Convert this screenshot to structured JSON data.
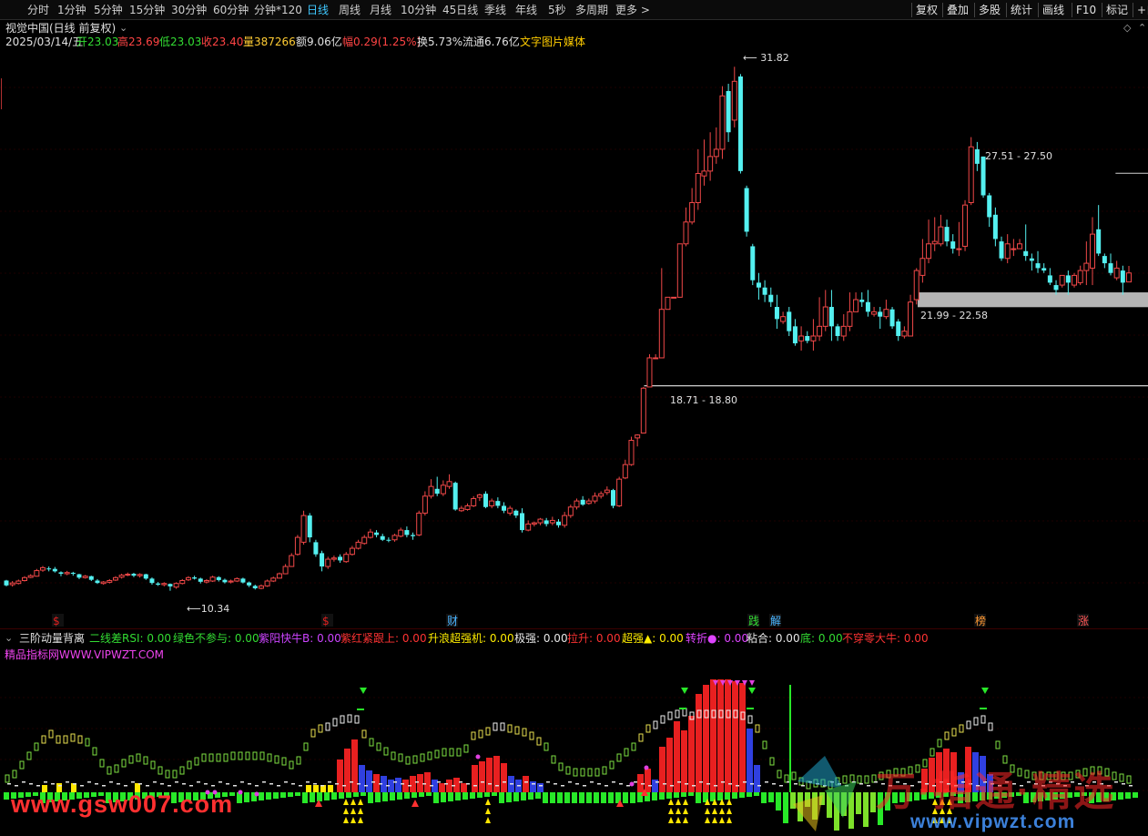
{
  "toolbar": {
    "periods": [
      "分时",
      "1分钟",
      "5分钟",
      "15分钟",
      "30分钟",
      "60分钟",
      "分钟*120",
      "日线",
      "周线",
      "月线",
      "10分钟",
      "45日线",
      "季线",
      "年线",
      "5秒",
      "多周期",
      "更多 >"
    ],
    "active": "日线",
    "right": [
      "复权",
      "叠加",
      "多股",
      "统计",
      "画线",
      "F10",
      "标记",
      "+自"
    ]
  },
  "stock": {
    "title": "视觉中国(日线 前复权)"
  },
  "quote": {
    "date": "2025/03/14/五",
    "open_label": "开",
    "open": "23.03",
    "high_label": "高",
    "high": "23.69",
    "low_label": "低",
    "low": "23.03",
    "close_label": "收",
    "close": "23.40",
    "vol_label": "量",
    "vol": "387266",
    "amt_label": "额",
    "amt": "9.06亿",
    "chg_label": "幅",
    "chg": "0.29(1.25%)",
    "turn_label": "换",
    "turn": "5.73%",
    "float_label": "流通",
    "float": "6.76亿",
    "tags": "文字图片媒体"
  },
  "chart_data": {
    "type": "candlestick",
    "ylim": [
      9.8,
      32.4
    ],
    "candles": [
      [
        10.72,
        10.52,
        10.75,
        10.48
      ],
      [
        10.55,
        10.62,
        10.7,
        10.47
      ],
      [
        10.6,
        10.7,
        10.76,
        10.56
      ],
      [
        10.72,
        10.84,
        10.9,
        10.68
      ],
      [
        10.85,
        10.92,
        10.98,
        10.82
      ],
      [
        10.9,
        11.13,
        11.2,
        10.88
      ],
      [
        11.15,
        11.25,
        11.32,
        11.08
      ],
      [
        11.22,
        11.18,
        11.3,
        11.1
      ],
      [
        11.2,
        11.1,
        11.28,
        11.05
      ],
      [
        11.06,
        11.0,
        11.1,
        10.9
      ],
      [
        11.0,
        11.05,
        11.12,
        10.94
      ],
      [
        11.04,
        11.0,
        11.08,
        10.92
      ],
      [
        10.98,
        10.84,
        11.0,
        10.78
      ],
      [
        10.84,
        10.9,
        10.95,
        10.8
      ],
      [
        10.9,
        10.75,
        10.92,
        10.7
      ],
      [
        10.72,
        10.62,
        10.78,
        10.58
      ],
      [
        10.6,
        10.66,
        10.7,
        10.55
      ],
      [
        10.65,
        10.72,
        10.78,
        10.6
      ],
      [
        10.74,
        10.84,
        10.9,
        10.7
      ],
      [
        10.86,
        10.94,
        11.0,
        10.8
      ],
      [
        10.95,
        10.98,
        11.05,
        10.9
      ],
      [
        11.0,
        10.92,
        11.04,
        10.86
      ],
      [
        10.92,
        10.97,
        11.02,
        10.84
      ],
      [
        10.98,
        10.8,
        11.0,
        10.75
      ],
      [
        10.8,
        10.62,
        10.85,
        10.55
      ],
      [
        10.6,
        10.55,
        10.66,
        10.5
      ],
      [
        10.55,
        10.6,
        10.65,
        10.48
      ],
      [
        10.58,
        10.48,
        10.6,
        10.3
      ],
      [
        10.45,
        10.6,
        10.65,
        10.38
      ],
      [
        10.6,
        10.72,
        10.78,
        10.56
      ],
      [
        10.75,
        10.84,
        10.9,
        10.7
      ],
      [
        10.85,
        10.8,
        10.92,
        10.76
      ],
      [
        10.8,
        10.67,
        10.84,
        10.6
      ],
      [
        10.66,
        10.72,
        10.78,
        10.6
      ],
      [
        10.7,
        10.86,
        10.92,
        10.66
      ],
      [
        10.86,
        10.74,
        10.9,
        10.68
      ],
      [
        10.75,
        10.65,
        10.8,
        10.6
      ],
      [
        10.66,
        10.7,
        10.76,
        10.6
      ],
      [
        10.7,
        10.8,
        10.85,
        10.66
      ],
      [
        10.8,
        10.64,
        10.84,
        10.6
      ],
      [
        10.64,
        10.52,
        10.68,
        10.45
      ],
      [
        10.5,
        10.4,
        10.55,
        10.35
      ],
      [
        10.4,
        10.5,
        10.56,
        10.36
      ],
      [
        10.5,
        10.7,
        10.76,
        10.46
      ],
      [
        10.7,
        10.82,
        10.88,
        10.66
      ],
      [
        10.82,
        11.0,
        11.05,
        10.8
      ],
      [
        11.0,
        11.3,
        11.4,
        10.98
      ],
      [
        11.3,
        11.75,
        11.85,
        11.28
      ],
      [
        11.8,
        12.5,
        12.6,
        11.75
      ],
      [
        12.3,
        13.4,
        13.6,
        12.2
      ],
      [
        13.4,
        12.5,
        13.5,
        12.3
      ],
      [
        12.3,
        11.8,
        12.4,
        11.7
      ],
      [
        11.85,
        11.3,
        11.95,
        11.1
      ],
      [
        11.3,
        11.6,
        11.7,
        11.2
      ],
      [
        11.6,
        11.65,
        11.75,
        11.5
      ],
      [
        11.7,
        11.55,
        11.8,
        11.45
      ],
      [
        11.5,
        11.8,
        11.9,
        11.45
      ],
      [
        11.8,
        12.05,
        12.15,
        11.75
      ],
      [
        12.05,
        12.3,
        12.4,
        12.0
      ],
      [
        12.25,
        12.5,
        12.6,
        12.2
      ],
      [
        12.5,
        12.72,
        12.85,
        12.45
      ],
      [
        12.7,
        12.6,
        12.8,
        12.5
      ],
      [
        12.55,
        12.4,
        12.65,
        12.35
      ],
      [
        12.4,
        12.38,
        12.5,
        12.3
      ],
      [
        12.4,
        12.58,
        12.65,
        12.32
      ],
      [
        12.55,
        12.8,
        12.9,
        12.5
      ],
      [
        12.8,
        12.6,
        12.95,
        12.5
      ],
      [
        12.6,
        12.55,
        12.7,
        12.4
      ],
      [
        12.6,
        13.5,
        13.6,
        12.55
      ],
      [
        13.5,
        14.2,
        14.4,
        13.4
      ],
      [
        14.2,
        14.6,
        14.9,
        14.1
      ],
      [
        14.5,
        14.3,
        15.0,
        14.2
      ],
      [
        14.3,
        14.65,
        14.85,
        14.2
      ],
      [
        14.6,
        14.8,
        15.1,
        14.5
      ],
      [
        14.75,
        13.65,
        14.8,
        13.6
      ],
      [
        13.6,
        13.7,
        13.8,
        13.55
      ],
      [
        13.65,
        13.8,
        13.9,
        13.6
      ],
      [
        13.8,
        14.1,
        14.2,
        13.75
      ],
      [
        14.15,
        14.25,
        14.3,
        14.0
      ],
      [
        14.3,
        13.75,
        14.4,
        13.7
      ],
      [
        13.8,
        14.0,
        14.1,
        13.7
      ],
      [
        14.0,
        13.8,
        14.15,
        13.7
      ],
      [
        13.8,
        13.6,
        13.95,
        13.5
      ],
      [
        13.5,
        13.7,
        13.8,
        13.4
      ],
      [
        13.6,
        13.4,
        13.65,
        13.3
      ],
      [
        13.5,
        12.8,
        13.7,
        12.7
      ],
      [
        12.8,
        13.05,
        13.2,
        12.75
      ],
      [
        13.05,
        13.1,
        13.15,
        12.95
      ],
      [
        13.1,
        13.25,
        13.3,
        13.0
      ],
      [
        13.2,
        13.05,
        13.3,
        12.95
      ],
      [
        13.1,
        13.2,
        13.35,
        13.0
      ],
      [
        13.15,
        13.0,
        13.25,
        12.9
      ],
      [
        13.0,
        13.4,
        13.55,
        12.9
      ],
      [
        13.4,
        13.75,
        13.85,
        13.3
      ],
      [
        13.75,
        14.0,
        14.1,
        13.65
      ],
      [
        14.05,
        13.85,
        14.2,
        13.8
      ],
      [
        13.9,
        14.0,
        14.1,
        13.85
      ],
      [
        14.0,
        14.2,
        14.35,
        13.9
      ],
      [
        14.2,
        14.3,
        14.4,
        14.1
      ],
      [
        14.35,
        14.45,
        14.6,
        14.25
      ],
      [
        14.45,
        13.8,
        14.5,
        13.7
      ],
      [
        13.8,
        14.9,
        15.0,
        13.75
      ],
      [
        14.95,
        15.5,
        15.7,
        14.9
      ],
      [
        15.5,
        16.5,
        16.65,
        15.45
      ],
      [
        16.6,
        16.72,
        16.75,
        16.25
      ],
      [
        16.8,
        18.65,
        18.7,
        18.6
      ],
      [
        18.7,
        19.9,
        20.05,
        18.7
      ],
      [
        19.9,
        19.9,
        20.05,
        19.9
      ],
      [
        19.9,
        21.9,
        23.6,
        19.9
      ],
      [
        21.9,
        22.4,
        22.4,
        22.0
      ],
      [
        22.4,
        22.4,
        22.4,
        22.4
      ],
      [
        22.4,
        24.6,
        24.6,
        22.4
      ],
      [
        24.6,
        25.5,
        26.1,
        24.5
      ],
      [
        25.5,
        26.3,
        26.9,
        25.4
      ],
      [
        26.3,
        27.5,
        28.5,
        26.0
      ],
      [
        27.4,
        27.6,
        28.9,
        27.0
      ],
      [
        27.6,
        28.2,
        29.2,
        27.2
      ],
      [
        28.2,
        28.5,
        29.4,
        27.9
      ],
      [
        28.5,
        30.7,
        31.1,
        28.1
      ],
      [
        30.9,
        29.2,
        31.2,
        28.8
      ],
      [
        29.7,
        31.3,
        31.9,
        29.4
      ],
      [
        31.5,
        27.6,
        31.6,
        27.5
      ],
      [
        26.9,
        25.1,
        27.0,
        24.9
      ],
      [
        24.5,
        23.1,
        24.6,
        22.9
      ],
      [
        23.0,
        22.8,
        23.4,
        22.3
      ],
      [
        22.8,
        22.5,
        23.1,
        22.2
      ],
      [
        22.5,
        22.2,
        22.8,
        22.0
      ],
      [
        22.0,
        21.5,
        22.5,
        21.1
      ],
      [
        21.4,
        21.6,
        21.8,
        21.3
      ],
      [
        21.8,
        21.0,
        22.0,
        20.8
      ],
      [
        21.2,
        20.5,
        21.5,
        20.4
      ],
      [
        20.6,
        20.8,
        21.2,
        20.2
      ],
      [
        20.8,
        20.6,
        21.0,
        20.5
      ],
      [
        20.6,
        20.8,
        21.5,
        20.2
      ],
      [
        20.8,
        21.2,
        22.4,
        20.6
      ],
      [
        21.2,
        22.0,
        22.7,
        21.0
      ],
      [
        22.0,
        21.2,
        22.7,
        20.6
      ],
      [
        21.2,
        20.8,
        21.3,
        20.6
      ],
      [
        20.8,
        21.2,
        21.7,
        20.6
      ],
      [
        21.2,
        21.8,
        22.6,
        21.0
      ],
      [
        21.8,
        22.3,
        22.6,
        21.8
      ],
      [
        22.3,
        22.2,
        22.6,
        22.0
      ],
      [
        22.2,
        21.8,
        22.7,
        21.6
      ],
      [
        21.7,
        21.8,
        22.0,
        21.6
      ],
      [
        21.8,
        21.6,
        22.0,
        21.1
      ],
      [
        21.6,
        21.9,
        22.3,
        21.5
      ],
      [
        21.9,
        21.2,
        22.0,
        21.1
      ],
      [
        21.4,
        20.8,
        21.5,
        20.6
      ],
      [
        20.8,
        21.0,
        21.2,
        20.7
      ],
      [
        20.8,
        22.2,
        22.5,
        20.8
      ],
      [
        22.3,
        23.5,
        23.6,
        22.1
      ],
      [
        23.3,
        24.0,
        24.8,
        23.0
      ],
      [
        24.0,
        24.6,
        25.6,
        23.8
      ],
      [
        24.6,
        24.7,
        25.7,
        24.3
      ],
      [
        24.6,
        25.3,
        25.8,
        24.5
      ],
      [
        25.3,
        24.7,
        25.6,
        24.5
      ],
      [
        24.7,
        24.4,
        25.0,
        24.2
      ],
      [
        24.4,
        24.4,
        25.5,
        24.1
      ],
      [
        24.5,
        26.2,
        26.4,
        24.3
      ],
      [
        26.3,
        28.6,
        29.0,
        26.2
      ],
      [
        28.5,
        27.9,
        28.8,
        27.6
      ],
      [
        28.2,
        26.6,
        28.2,
        26.5
      ],
      [
        26.6,
        25.7,
        26.7,
        25.3
      ],
      [
        25.8,
        24.8,
        26.1,
        24.5
      ],
      [
        24.7,
        24.0,
        24.9,
        23.9
      ],
      [
        24.0,
        24.6,
        25.0,
        23.8
      ],
      [
        24.4,
        24.4,
        24.8,
        24.1
      ],
      [
        24.4,
        24.6,
        24.8,
        24.4
      ],
      [
        24.3,
        24.1,
        25.4,
        23.9
      ],
      [
        24.0,
        23.9,
        24.2,
        23.5
      ],
      [
        23.8,
        23.6,
        24.3,
        23.4
      ],
      [
        23.6,
        23.5,
        23.8,
        23.4
      ],
      [
        23.3,
        23.0,
        23.6,
        22.9
      ],
      [
        22.9,
        22.7,
        23.1,
        22.5
      ],
      [
        22.9,
        23.3,
        23.3,
        22.8
      ],
      [
        23.3,
        23.0,
        23.5,
        22.5
      ],
      [
        22.9,
        23.3,
        23.4,
        22.8
      ],
      [
        23.0,
        23.5,
        23.7,
        22.9
      ],
      [
        23.5,
        23.8,
        24.7,
        22.9
      ],
      [
        23.6,
        25.0,
        25.7,
        22.9
      ],
      [
        25.2,
        24.2,
        26.2,
        24.1
      ],
      [
        24.1,
        23.8,
        24.2,
        23.6
      ],
      [
        23.8,
        23.4,
        24.2,
        23.3
      ],
      [
        23.2,
        23.6,
        23.9,
        23.1
      ],
      [
        23.5,
        23.0,
        23.7,
        22.5
      ],
      [
        23.03,
        23.4,
        23.69,
        23.03
      ]
    ],
    "annotations": {
      "high_label": "31.82",
      "low_label": "10.34",
      "zone_top": "27.51 - 27.50",
      "zone_mid": "21.99 - 22.58",
      "zone_bottom": "18.71 - 18.80"
    },
    "event_markers": [
      {
        "label": "$",
        "color": "#e02020"
      },
      {
        "label": "$",
        "color": "#e02020"
      },
      {
        "label": "财",
        "color": "#49b4ff"
      },
      {
        "label": "践",
        "color": "#33dd33"
      },
      {
        "label": "解",
        "color": "#49b4ff"
      },
      {
        "label": "榜",
        "color": "#ff9933"
      },
      {
        "label": "涨",
        "color": "#ff5555"
      }
    ]
  },
  "indicator": {
    "name": "三阶动量背离",
    "site": "精品指标网WWW.VIPWZT.COM",
    "items": [
      {
        "label": "二线差RSI:",
        "value": "0.00",
        "color": "#33dd33"
      },
      {
        "label": "绿色不参与:",
        "value": "0.00",
        "color": "#33dd33"
      },
      {
        "label": "紫阳快牛B:",
        "value": "0.00",
        "color": "#cc44ff"
      },
      {
        "label": "紫红紧跟上:",
        "value": "0.00",
        "color": "#ff3333"
      },
      {
        "label": "升浪超强机:",
        "value": "0.00",
        "color": "#ffee00"
      },
      {
        "label": "极强:",
        "value": "0.00",
        "color": "#e6e6e6"
      },
      {
        "label": "拉升:",
        "value": "0.00",
        "color": "#ff3333"
      },
      {
        "label": "超强▲:",
        "value": "0.00",
        "color": "#ffee00"
      },
      {
        "label": "转折●:",
        "value": "0.00",
        "color": "#dd44ff"
      },
      {
        "label": "粘合:",
        "value": "0.00",
        "color": "#e6e6e6"
      },
      {
        "label": "底:",
        "value": "0.00",
        "color": "#33dd33"
      },
      {
        "label": "不穿零大牛:",
        "value": "0.00",
        "color": "#ff3333"
      }
    ]
  },
  "watermarks": {
    "left": "www.gsw007.com",
    "right": "www.vipwzt.com",
    "big": "万·指通·精选"
  },
  "colors": {
    "up": "#f04848",
    "down": "#54f0f0",
    "active": "#3fc8ff",
    "pink": "#d040ff"
  }
}
